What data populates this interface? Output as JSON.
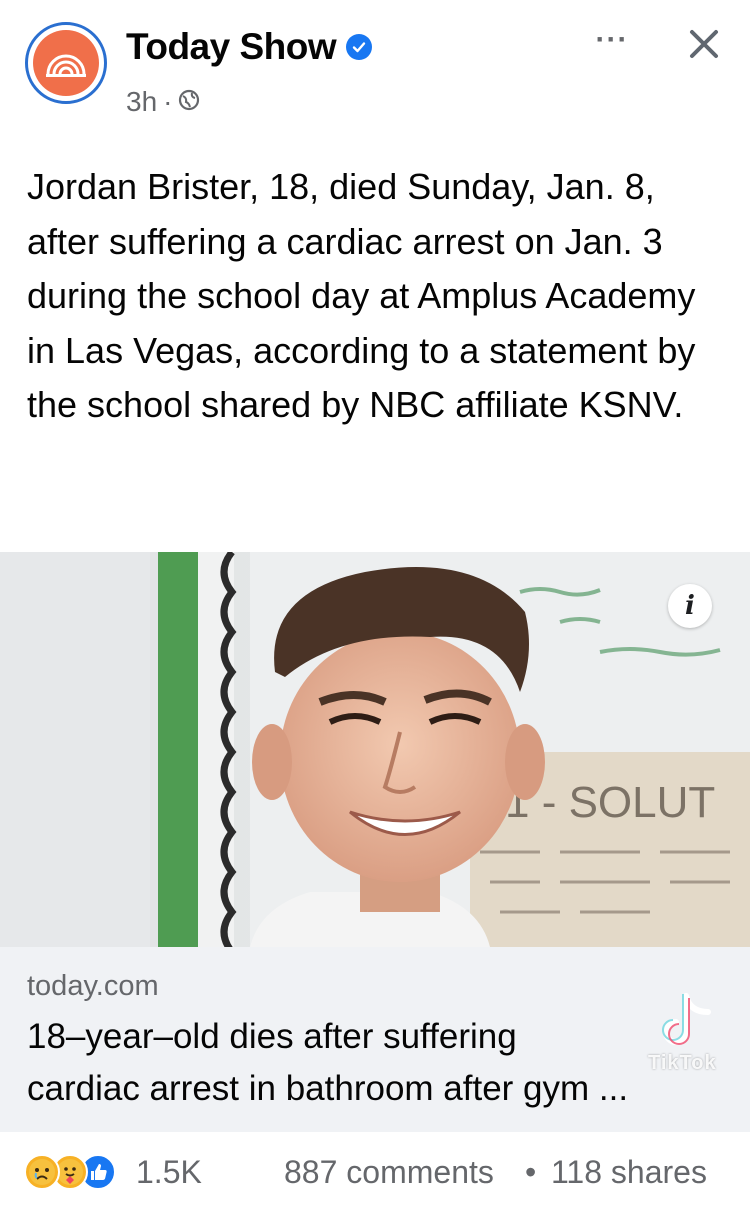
{
  "post": {
    "page_name": "Today Show",
    "time": "3h",
    "separator": "·",
    "body": "Jordan Brister, 18, died Sunday, Jan. 8, after suffering a cardiac arrest on Jan. 3 during the school day at Amplus Academy in Las Vegas, according to a statement by the school shared by NBC affiliate KSNV.",
    "more_label": "···",
    "close_label": "✕"
  },
  "photo": {
    "whiteboard_text": "1 - SOLUT",
    "info_label": "i"
  },
  "link": {
    "domain": "today.com",
    "title_line1": "18–year–old dies after suffering",
    "title_line2": "cardiac arrest in bathroom after gym ..."
  },
  "watermark": {
    "label": "TikTok"
  },
  "footer": {
    "reaction_count": "1.5K",
    "comments": "887 comments",
    "dot": "•",
    "shares": "118 shares"
  },
  "colors": {
    "brand_blue": "#1877f2",
    "avatar_orange": "#f06f4a",
    "secondary_text": "#65676b",
    "card_bg": "#f0f2f5"
  },
  "icons": [
    "today-show-logo-icon",
    "verified-badge-icon",
    "globe-icon",
    "more-icon",
    "close-icon",
    "info-icon",
    "tiktok-icon",
    "sad-reaction-icon",
    "care-reaction-icon",
    "like-reaction-icon"
  ]
}
